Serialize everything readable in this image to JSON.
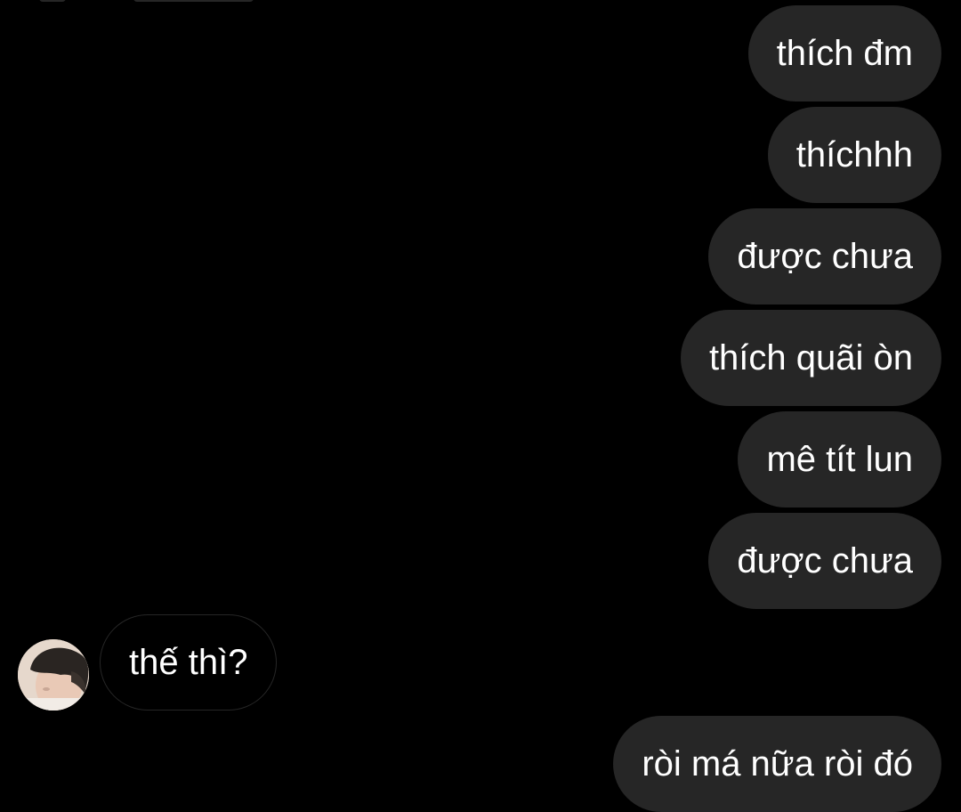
{
  "conversation": {
    "messages": [
      {
        "sender": "me",
        "text": "thích đm"
      },
      {
        "sender": "me",
        "text": "thíchhh"
      },
      {
        "sender": "me",
        "text": "được chưa"
      },
      {
        "sender": "me",
        "text": "thích quãi òn"
      },
      {
        "sender": "me",
        "text": "mê tít lun"
      },
      {
        "sender": "me",
        "text": "được chưa"
      },
      {
        "sender": "them",
        "text": "thế thì?"
      },
      {
        "sender": "me",
        "text": "ròi má nữa ròi đó"
      }
    ]
  },
  "theme": {
    "background": "#000000",
    "outgoing_bubble": "#262626",
    "incoming_border": "#262626",
    "text_color": "#ffffff"
  },
  "avatar": {
    "icon": "profile-photo"
  }
}
